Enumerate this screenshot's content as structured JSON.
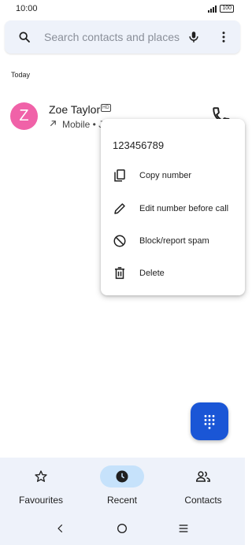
{
  "status_bar": {
    "time": "10:00",
    "battery": "100"
  },
  "search": {
    "placeholder": "Search contacts and places"
  },
  "section_label": "Today",
  "call_log": [
    {
      "name": "Zoe Taylor",
      "avatar_letter": "Z",
      "avatar_color": "#f062a8",
      "badge": "HD",
      "direction": "outgoing",
      "details": "Mobile • J"
    }
  ],
  "context_menu": {
    "number": "123456789",
    "items": [
      {
        "label": "Copy number",
        "icon": "copy-icon"
      },
      {
        "label": "Edit number before call",
        "icon": "pencil-icon"
      },
      {
        "label": "Block/report spam",
        "icon": "block-icon"
      },
      {
        "label": "Delete",
        "icon": "trash-icon"
      }
    ]
  },
  "fab": {
    "icon": "dialpad-icon",
    "color": "#1a56d6"
  },
  "bottom_nav": {
    "items": [
      {
        "label": "Favourites",
        "icon": "star-icon",
        "active": false
      },
      {
        "label": "Recent",
        "icon": "clock-icon",
        "active": true
      },
      {
        "label": "Contacts",
        "icon": "people-icon",
        "active": false
      }
    ]
  },
  "system_nav": [
    "back-icon",
    "home-icon",
    "recents-icon"
  ],
  "colors": {
    "accent": "#1a56d6",
    "active_pill": "#c6e2fb",
    "surface": "#eef2fa"
  }
}
